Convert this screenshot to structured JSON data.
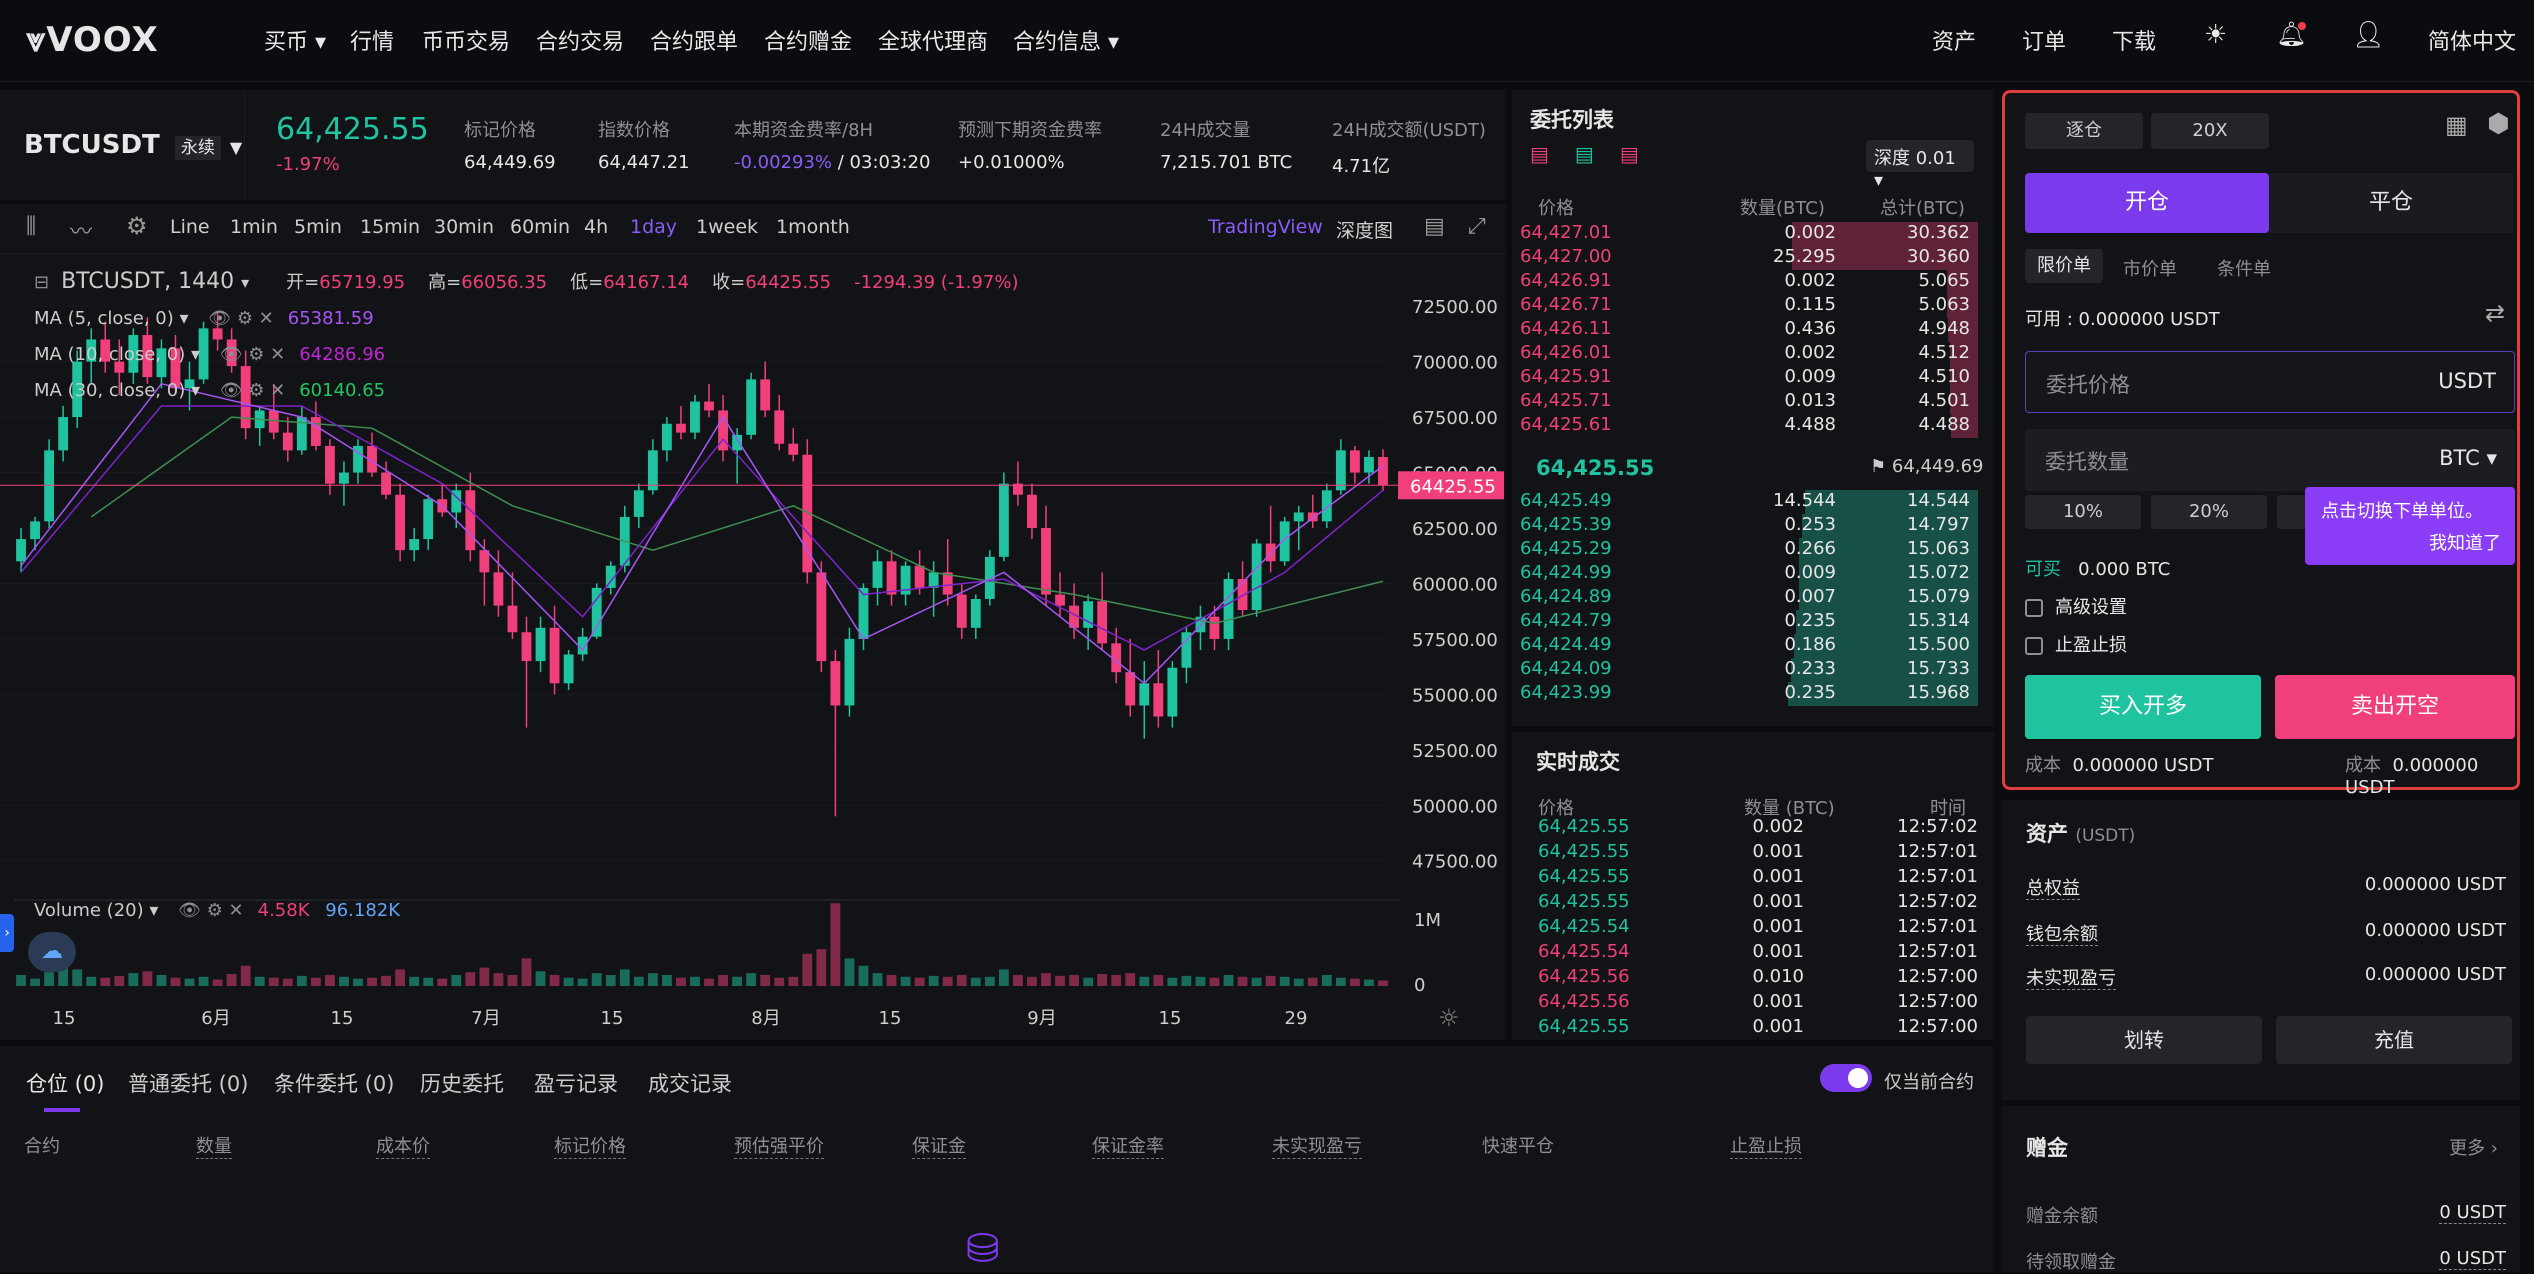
{
  "nav": {
    "logo": "VOOX",
    "items": [
      "买币",
      "行情",
      "币币交易",
      "合约交易",
      "合约跟单",
      "合约赠金",
      "全球代理商",
      "合约信息"
    ],
    "right": [
      "资产",
      "订单",
      "下载"
    ],
    "lang": "简体中文"
  },
  "ticker": {
    "symbol": "BTCUSDT",
    "type": "永续",
    "price": "64,425.55",
    "change": "-1.97%",
    "stats": [
      {
        "label": "标记价格",
        "value": "64,449.69"
      },
      {
        "label": "指数价格",
        "value": "64,447.21"
      },
      {
        "label": "本期资金费率/8H",
        "value": "-0.00293%",
        "value2": " / 03:03:20"
      },
      {
        "label": "预测下期资金费率",
        "value": "+0.01000%"
      },
      {
        "label": "24H成交量",
        "value": "7,215.701 BTC"
      },
      {
        "label": "24H成交额(USDT)",
        "value": "4.71亿"
      }
    ]
  },
  "toolbar": {
    "line": "Line",
    "timeframes": [
      "1min",
      "5min",
      "15min",
      "30min",
      "60min",
      "4h",
      "1day",
      "1week",
      "1month"
    ],
    "active": "1day",
    "tradingview": "TradingView",
    "depth": "深度图"
  },
  "chart": {
    "symbol": "BTCUSDT, 1440",
    "ohlc": {
      "o_label": "开=",
      "o": "65719.95",
      "h_label": "高=",
      "h": "66056.35",
      "l_label": "低=",
      "l": "64167.14",
      "c_label": "收=",
      "c": "64425.55",
      "chg": "-1294.39 (-1.97%)"
    },
    "ma": [
      {
        "label": "MA (5, close, 0)",
        "value": "65381.59",
        "color": "#a855f7"
      },
      {
        "label": "MA (10, close, 0)",
        "value": "64286.96",
        "color": "#a855f7"
      },
      {
        "label": "MA (30, close, 0)",
        "value": "60140.65",
        "color": "#22c55e"
      }
    ],
    "price_axis": [
      "72500.00",
      "70000.00",
      "67500.00",
      "65000.00",
      "62500.00",
      "60000.00",
      "57500.00",
      "55000.00",
      "52500.00",
      "50000.00",
      "47500.00"
    ],
    "last_price": "64425.55",
    "volume_label": "Volume (20)",
    "vol1": "4.58K",
    "vol2": "96.182K",
    "vol_axis": [
      "1M",
      "0"
    ],
    "date_axis": [
      "15",
      "6月",
      "15",
      "7月",
      "15",
      "8月",
      "15",
      "9月",
      "15",
      "29"
    ]
  },
  "chart_data": {
    "type": "candlestick",
    "ylim": [
      46000,
      73500
    ],
    "last": 64425.55,
    "candles": [
      [
        61000,
        62500,
        60500,
        62000
      ],
      [
        62000,
        63000,
        61500,
        62800
      ],
      [
        62800,
        66500,
        62500,
        66000
      ],
      [
        66000,
        68000,
        65500,
        67500
      ],
      [
        67500,
        70500,
        67000,
        70000
      ],
      [
        70000,
        71500,
        69000,
        71000
      ],
      [
        71000,
        71800,
        69500,
        70000
      ],
      [
        70000,
        71000,
        68500,
        69500
      ],
      [
        69500,
        71500,
        69000,
        71200
      ],
      [
        71200,
        72000,
        69000,
        69300
      ],
      [
        69300,
        71000,
        68800,
        70600
      ],
      [
        70600,
        71200,
        68500,
        68800
      ],
      [
        68800,
        70000,
        67800,
        69200
      ],
      [
        69200,
        71800,
        69000,
        71500
      ],
      [
        71500,
        72200,
        70500,
        71000
      ],
      [
        71000,
        71500,
        69500,
        69800
      ],
      [
        69800,
        70500,
        66500,
        67000
      ],
      [
        67000,
        68000,
        66200,
        67800
      ],
      [
        67800,
        69000,
        66500,
        66800
      ],
      [
        66800,
        67500,
        65500,
        66000
      ],
      [
        66000,
        68000,
        65800,
        67500
      ],
      [
        67500,
        68200,
        66000,
        66200
      ],
      [
        66200,
        66500,
        64000,
        64500
      ],
      [
        64500,
        65500,
        63500,
        65000
      ],
      [
        65000,
        66500,
        64500,
        66200
      ],
      [
        66200,
        66800,
        64800,
        65000
      ],
      [
        65000,
        65500,
        63800,
        64000
      ],
      [
        64000,
        64500,
        61000,
        61500
      ],
      [
        61500,
        62500,
        61000,
        62000
      ],
      [
        62000,
        64000,
        61500,
        63800
      ],
      [
        63800,
        64500,
        63000,
        63200
      ],
      [
        63200,
        64500,
        62500,
        64200
      ],
      [
        64200,
        65000,
        61000,
        61500
      ],
      [
        61500,
        62000,
        59000,
        60500
      ],
      [
        60500,
        61500,
        58500,
        59000
      ],
      [
        59000,
        60500,
        57500,
        57800
      ],
      [
        57800,
        58500,
        53500,
        56500
      ],
      [
        56500,
        58500,
        56000,
        58000
      ],
      [
        58000,
        59000,
        55000,
        55500
      ],
      [
        55500,
        57000,
        55200,
        56800
      ],
      [
        56800,
        58000,
        56500,
        57600
      ],
      [
        57600,
        60000,
        57500,
        59800
      ],
      [
        59800,
        61000,
        59500,
        60800
      ],
      [
        60800,
        63500,
        60500,
        63000
      ],
      [
        63000,
        64500,
        62500,
        64200
      ],
      [
        64200,
        66500,
        64000,
        66000
      ],
      [
        66000,
        67500,
        65500,
        67200
      ],
      [
        67200,
        68000,
        66500,
        66800
      ],
      [
        66800,
        68500,
        66500,
        68200
      ],
      [
        68200,
        69000,
        67500,
        67800
      ],
      [
        67800,
        68500,
        65500,
        66000
      ],
      [
        66000,
        67000,
        64500,
        66700
      ],
      [
        66700,
        69500,
        66500,
        69200
      ],
      [
        69200,
        70000,
        67500,
        67800
      ],
      [
        67800,
        68500,
        66000,
        66300
      ],
      [
        66300,
        67000,
        65500,
        65800
      ],
      [
        65800,
        66500,
        60000,
        60500
      ],
      [
        60500,
        61000,
        56000,
        56500
      ],
      [
        56500,
        57000,
        49500,
        54500
      ],
      [
        54500,
        58000,
        54000,
        57500
      ],
      [
        57500,
        60000,
        57000,
        59800
      ],
      [
        59800,
        61500,
        59000,
        61000
      ],
      [
        61000,
        61500,
        59000,
        59500
      ],
      [
        59500,
        61000,
        59000,
        60800
      ],
      [
        60800,
        61500,
        59500,
        59800
      ],
      [
        59800,
        61000,
        58500,
        60500
      ],
      [
        60500,
        62000,
        59000,
        59500
      ],
      [
        59500,
        60000,
        57500,
        58000
      ],
      [
        58000,
        59500,
        57500,
        59300
      ],
      [
        59300,
        61500,
        59000,
        61200
      ],
      [
        61200,
        65000,
        61000,
        64500
      ],
      [
        64500,
        65500,
        63500,
        64000
      ],
      [
        64000,
        64500,
        62000,
        62500
      ],
      [
        62500,
        63500,
        59000,
        59500
      ],
      [
        59500,
        60500,
        58500,
        59000
      ],
      [
        59000,
        60000,
        57500,
        58000
      ],
      [
        58000,
        59500,
        57000,
        59200
      ],
      [
        59200,
        60500,
        57000,
        57300
      ],
      [
        57300,
        58000,
        55500,
        56000
      ],
      [
        56000,
        57500,
        54000,
        54500
      ],
      [
        54500,
        56500,
        53000,
        55500
      ],
      [
        55500,
        57000,
        53500,
        54000
      ],
      [
        54000,
        56500,
        53500,
        56200
      ],
      [
        56200,
        58000,
        55500,
        57800
      ],
      [
        57800,
        59000,
        57000,
        58500
      ],
      [
        58500,
        59000,
        57000,
        57500
      ],
      [
        57500,
        60500,
        57000,
        60200
      ],
      [
        60200,
        61000,
        58500,
        58800
      ],
      [
        58800,
        62000,
        58500,
        61800
      ],
      [
        61800,
        63500,
        60500,
        61000
      ],
      [
        61000,
        63000,
        60800,
        62800
      ],
      [
        62800,
        63500,
        61500,
        63200
      ],
      [
        63200,
        64000,
        62500,
        62800
      ],
      [
        62800,
        64500,
        62500,
        64200
      ],
      [
        64200,
        66500,
        64000,
        66000
      ],
      [
        66000,
        66200,
        64500,
        65000
      ],
      [
        65000,
        66000,
        64500,
        65700
      ],
      [
        65700,
        66050,
        64167,
        64425
      ]
    ],
    "ma5": [
      [
        0,
        60800
      ],
      [
        10,
        69000
      ],
      [
        20,
        67500
      ],
      [
        30,
        63500
      ],
      [
        40,
        57000
      ],
      [
        50,
        67500
      ],
      [
        60,
        57500
      ],
      [
        70,
        60500
      ],
      [
        80,
        55500
      ],
      [
        90,
        62000
      ],
      [
        97,
        65300
      ]
    ],
    "ma10": [
      [
        0,
        60500
      ],
      [
        10,
        68000
      ],
      [
        20,
        68000
      ],
      [
        30,
        64500
      ],
      [
        40,
        58500
      ],
      [
        50,
        66500
      ],
      [
        60,
        59500
      ],
      [
        70,
        60200
      ],
      [
        80,
        57000
      ],
      [
        90,
        60500
      ],
      [
        97,
        64200
      ]
    ],
    "ma30": [
      [
        5,
        63000
      ],
      [
        15,
        67500
      ],
      [
        25,
        67000
      ],
      [
        35,
        63500
      ],
      [
        45,
        61500
      ],
      [
        55,
        63500
      ],
      [
        65,
        60500
      ],
      [
        75,
        59500
      ],
      [
        85,
        58200
      ],
      [
        97,
        60100
      ]
    ],
    "volumes": [
      12,
      8,
      15,
      20,
      18,
      10,
      9,
      11,
      14,
      16,
      12,
      9,
      8,
      10,
      7,
      13,
      22,
      10,
      9,
      8,
      11,
      9,
      12,
      10,
      8,
      9,
      11,
      18,
      10,
      9,
      8,
      12,
      15,
      20,
      14,
      12,
      30,
      16,
      12,
      9,
      8,
      14,
      12,
      18,
      10,
      14,
      12,
      9,
      10,
      8,
      12,
      10,
      14,
      12,
      9,
      10,
      35,
      40,
      90,
      30,
      22,
      14,
      12,
      10,
      9,
      11,
      10,
      12,
      9,
      10,
      18,
      12,
      10,
      14,
      11,
      12,
      9,
      13,
      12,
      14,
      10,
      12,
      9,
      11,
      10,
      9,
      12,
      10,
      9,
      11,
      10,
      8,
      9,
      12,
      9,
      8,
      7,
      6
    ]
  },
  "orderbook": {
    "title": "委托列表",
    "depth": "深度 0.01",
    "headers": [
      "价格",
      "数量(BTC)",
      "总计(BTC)"
    ],
    "asks": [
      [
        "64,427.01",
        "0.002",
        "30.362"
      ],
      [
        "64,427.00",
        "25.295",
        "30.360"
      ],
      [
        "64,426.91",
        "0.002",
        "5.065"
      ],
      [
        "64,426.71",
        "0.115",
        "5.063"
      ],
      [
        "64,426.11",
        "0.436",
        "4.948"
      ],
      [
        "64,426.01",
        "0.002",
        "4.512"
      ],
      [
        "64,425.91",
        "0.009",
        "4.510"
      ],
      [
        "64,425.71",
        "0.013",
        "4.501"
      ],
      [
        "64,425.61",
        "4.488",
        "4.488"
      ]
    ],
    "mid": "64,425.55",
    "mark": "64,449.69",
    "bids": [
      [
        "64,425.49",
        "14.544",
        "14.544"
      ],
      [
        "64,425.39",
        "0.253",
        "14.797"
      ],
      [
        "64,425.29",
        "0.266",
        "15.063"
      ],
      [
        "64,424.99",
        "0.009",
        "15.072"
      ],
      [
        "64,424.89",
        "0.007",
        "15.079"
      ],
      [
        "64,424.79",
        "0.235",
        "15.314"
      ],
      [
        "64,424.49",
        "0.186",
        "15.500"
      ],
      [
        "64,424.09",
        "0.233",
        "15.733"
      ],
      [
        "64,423.99",
        "0.235",
        "15.968"
      ]
    ]
  },
  "trades": {
    "title": "实时成交",
    "headers": [
      "价格",
      "数量 (BTC)",
      "时间"
    ],
    "rows": [
      [
        "64,425.55",
        "0.002",
        "12:57:02",
        "g"
      ],
      [
        "64,425.55",
        "0.001",
        "12:57:01",
        "g"
      ],
      [
        "64,425.55",
        "0.001",
        "12:57:01",
        "g"
      ],
      [
        "64,425.55",
        "0.001",
        "12:57:02",
        "g"
      ],
      [
        "64,425.54",
        "0.001",
        "12:57:01",
        "g"
      ],
      [
        "64,425.54",
        "0.001",
        "12:57:01",
        "r"
      ],
      [
        "64,425.56",
        "0.010",
        "12:57:00",
        "r"
      ],
      [
        "64,425.56",
        "0.001",
        "12:57:00",
        "r"
      ],
      [
        "64,425.55",
        "0.001",
        "12:57:00",
        "g"
      ]
    ]
  },
  "order_form": {
    "margin_mode": "逐仓",
    "leverage": "20X",
    "open": "开仓",
    "close": "平仓",
    "types": [
      "限价单",
      "市价单",
      "条件单"
    ],
    "avail_label": "可用 : ",
    "avail": "0.000000 USDT",
    "price_placeholder": "委托价格",
    "price_unit": "USDT",
    "qty_placeholder": "委托数量",
    "qty_unit": "BTC",
    "pcts": [
      "10%",
      "20%"
    ],
    "tooltip": "点击切换下单单位。",
    "tooltip_btn": "我知道了",
    "can_buy_label": "可买",
    "can_buy": "0.000 BTC",
    "advanced": "高级设置",
    "tpsl": "止盈止损",
    "buy": "买入开多",
    "sell": "卖出开空",
    "cost_label": "成本",
    "cost_buy": "0.000000 USDT",
    "cost_sell": "0.000000 USDT"
  },
  "assets": {
    "title": "资产",
    "unit": "(USDT)",
    "rows": [
      [
        "总权益",
        "0.000000 USDT"
      ],
      [
        "钱包余额",
        "0.000000 USDT"
      ],
      [
        "未实现盈亏",
        "0.000000 USDT"
      ]
    ],
    "transfer": "划转",
    "deposit": "充值"
  },
  "bonus": {
    "title": "赠金",
    "more": "更多",
    "rows": [
      [
        "赠金余额",
        "0 USDT"
      ],
      [
        "待领取赠金",
        "0 USDT"
      ]
    ]
  },
  "positions": {
    "tabs": [
      "仓位 (0)",
      "普通委托 (0)",
      "条件委托 (0)",
      "历史委托",
      "盈亏记录",
      "成交记录"
    ],
    "toggle": "仅当前合约",
    "cols": [
      "合约",
      "数量",
      "成本价",
      "标记价格",
      "预估强平价",
      "保证金",
      "保证金率",
      "未实现盈亏",
      "快速平仓",
      "止盈止损"
    ]
  },
  "colors": {
    "green": "#1fc3a0",
    "red": "#f03f7a",
    "accent": "#8b5cf6"
  }
}
